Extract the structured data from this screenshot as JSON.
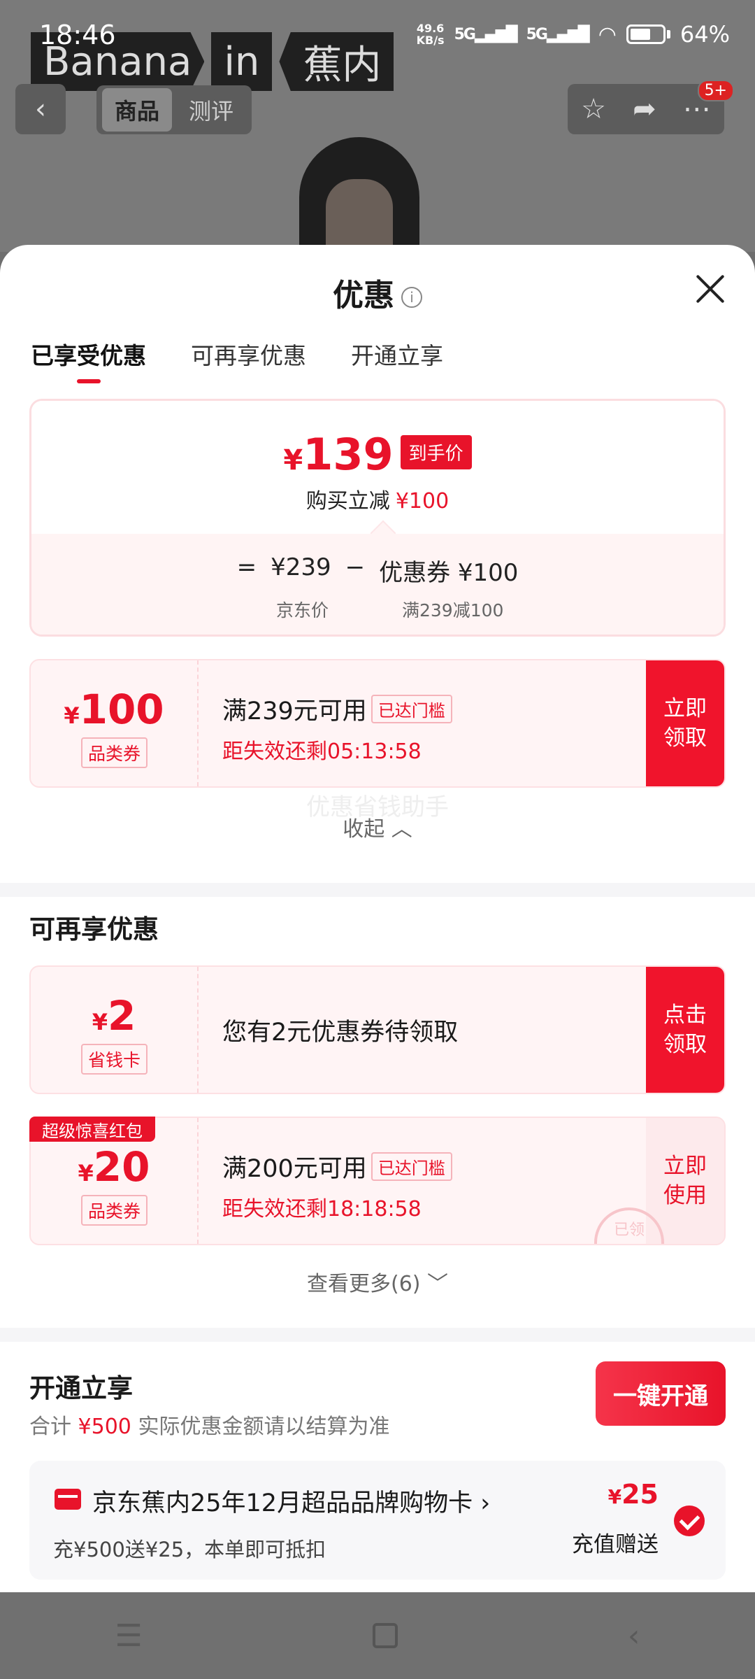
{
  "status_bar": {
    "time": "18:46",
    "net_speed": "49.6",
    "net_unit": "KB/s",
    "sig1": "5G",
    "sig2": "5G",
    "battery": "64%"
  },
  "brand": {
    "part1": "Banana",
    "part2": "in",
    "part3": "蕉内"
  },
  "top_nav": {
    "tab_product": "商品",
    "tab_review": "测评",
    "badge": "5+"
  },
  "sheet": {
    "title": "优惠",
    "tabs": [
      "已享受优惠",
      "可再享优惠",
      "开通立享"
    ]
  },
  "price_summary": {
    "currency": "¥",
    "final_price": "139",
    "final_tag": "到手价",
    "discount_label": "购买立减",
    "discount_value": "¥100",
    "eq": "=",
    "jd_price": "¥239",
    "minus": "−",
    "coupon_part": "优惠券 ¥100",
    "jd_price_label": "京东价",
    "coupon_rule": "满239减100"
  },
  "coupon1": {
    "currency": "¥",
    "value": "100",
    "type": "品类券",
    "condition": "满239元可用",
    "status": "已达门槛",
    "expire": "距失效还剩05:13:58",
    "button": "立即\n领取"
  },
  "watermark": "优惠省钱助手",
  "collapse": "收起 ︿",
  "more_section": {
    "title": "可再享优惠",
    "card1": {
      "currency": "¥",
      "value": "2",
      "type": "省钱卡",
      "text": "您有2元优惠券待领取",
      "button": "点击\n领取"
    },
    "card2": {
      "tag": "超级惊喜红包",
      "currency": "¥",
      "value": "20",
      "type": "品类券",
      "condition": "满200元可用",
      "status": "已达门槛",
      "expire": "距失效还剩18:18:58",
      "button": "立即\n使用",
      "stamp": "已领"
    },
    "more_link": "查看更多(6) ﹀"
  },
  "open_section": {
    "title": "开通立享",
    "note_prefix": "合计",
    "note_amount": "¥500",
    "note_suffix": "实际优惠金额请以结算为准",
    "button": "一键开通",
    "card_title": "京东蕉内25年12月超品品牌购物卡 ›",
    "card_sub": "充¥500送¥25，本单即可抵扣",
    "card_currency": "¥",
    "card_amount": "25",
    "card_amount_label": "充值赠送"
  },
  "colors": {
    "accent": "#e8132a",
    "coupon_bg": "#fff4f5"
  }
}
